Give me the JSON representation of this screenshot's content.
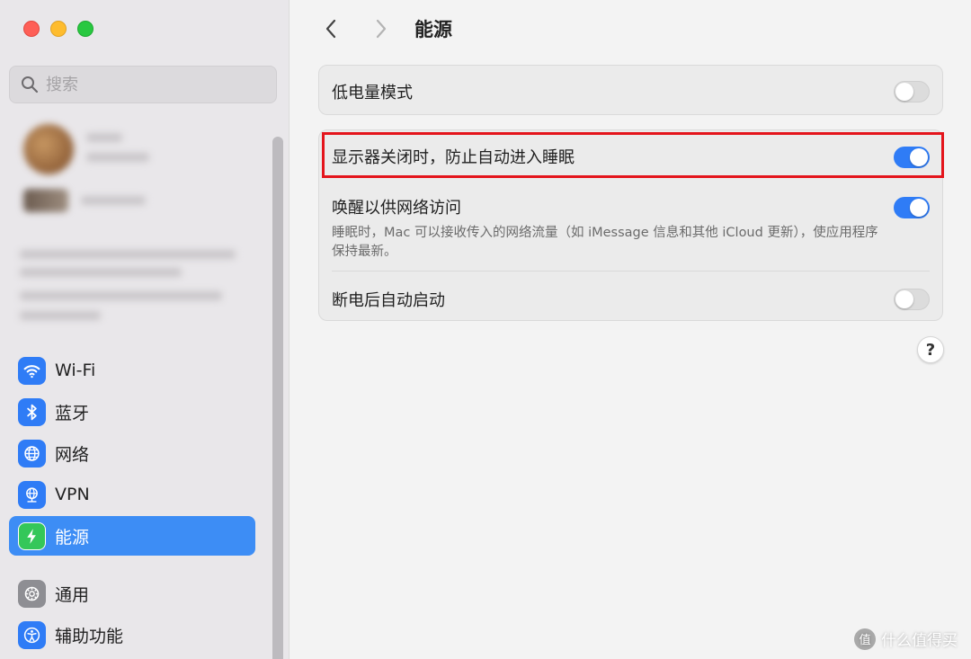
{
  "sidebar": {
    "search_placeholder": "搜索",
    "items": [
      {
        "label": "Wi-Fi",
        "icon": "wifi-icon"
      },
      {
        "label": "蓝牙",
        "icon": "bluetooth-icon"
      },
      {
        "label": "网络",
        "icon": "globe-icon"
      },
      {
        "label": "VPN",
        "icon": "vpn-globe-icon"
      },
      {
        "label": "能源",
        "icon": "bolt-icon",
        "active": true
      },
      {
        "label": "通用",
        "icon": "gear-icon"
      },
      {
        "label": "辅助功能",
        "icon": "accessibility-icon"
      }
    ]
  },
  "header": {
    "title": "能源"
  },
  "settings": {
    "low_power": {
      "label": "低电量模式",
      "enabled": false
    },
    "prevent_sleep": {
      "label": "显示器关闭时，防止自动进入睡眠",
      "enabled": true
    },
    "wake_network": {
      "label": "唤醒以供网络访问",
      "description": "睡眠时，Mac 可以接收传入的网络流量（如 iMessage 信息和其他 iCloud 更新），使应用程序保持最新。",
      "enabled": true
    },
    "auto_restart": {
      "label": "断电后自动启动",
      "enabled": false
    }
  },
  "help": {
    "label": "?"
  },
  "watermark": {
    "logo": "值",
    "text": "什么值得买"
  },
  "colors": {
    "accent": "#2f7cf6",
    "active_sidebar": "#3d8df5",
    "highlight_border": "#e4141b",
    "power_icon_bg": "#34c759"
  }
}
